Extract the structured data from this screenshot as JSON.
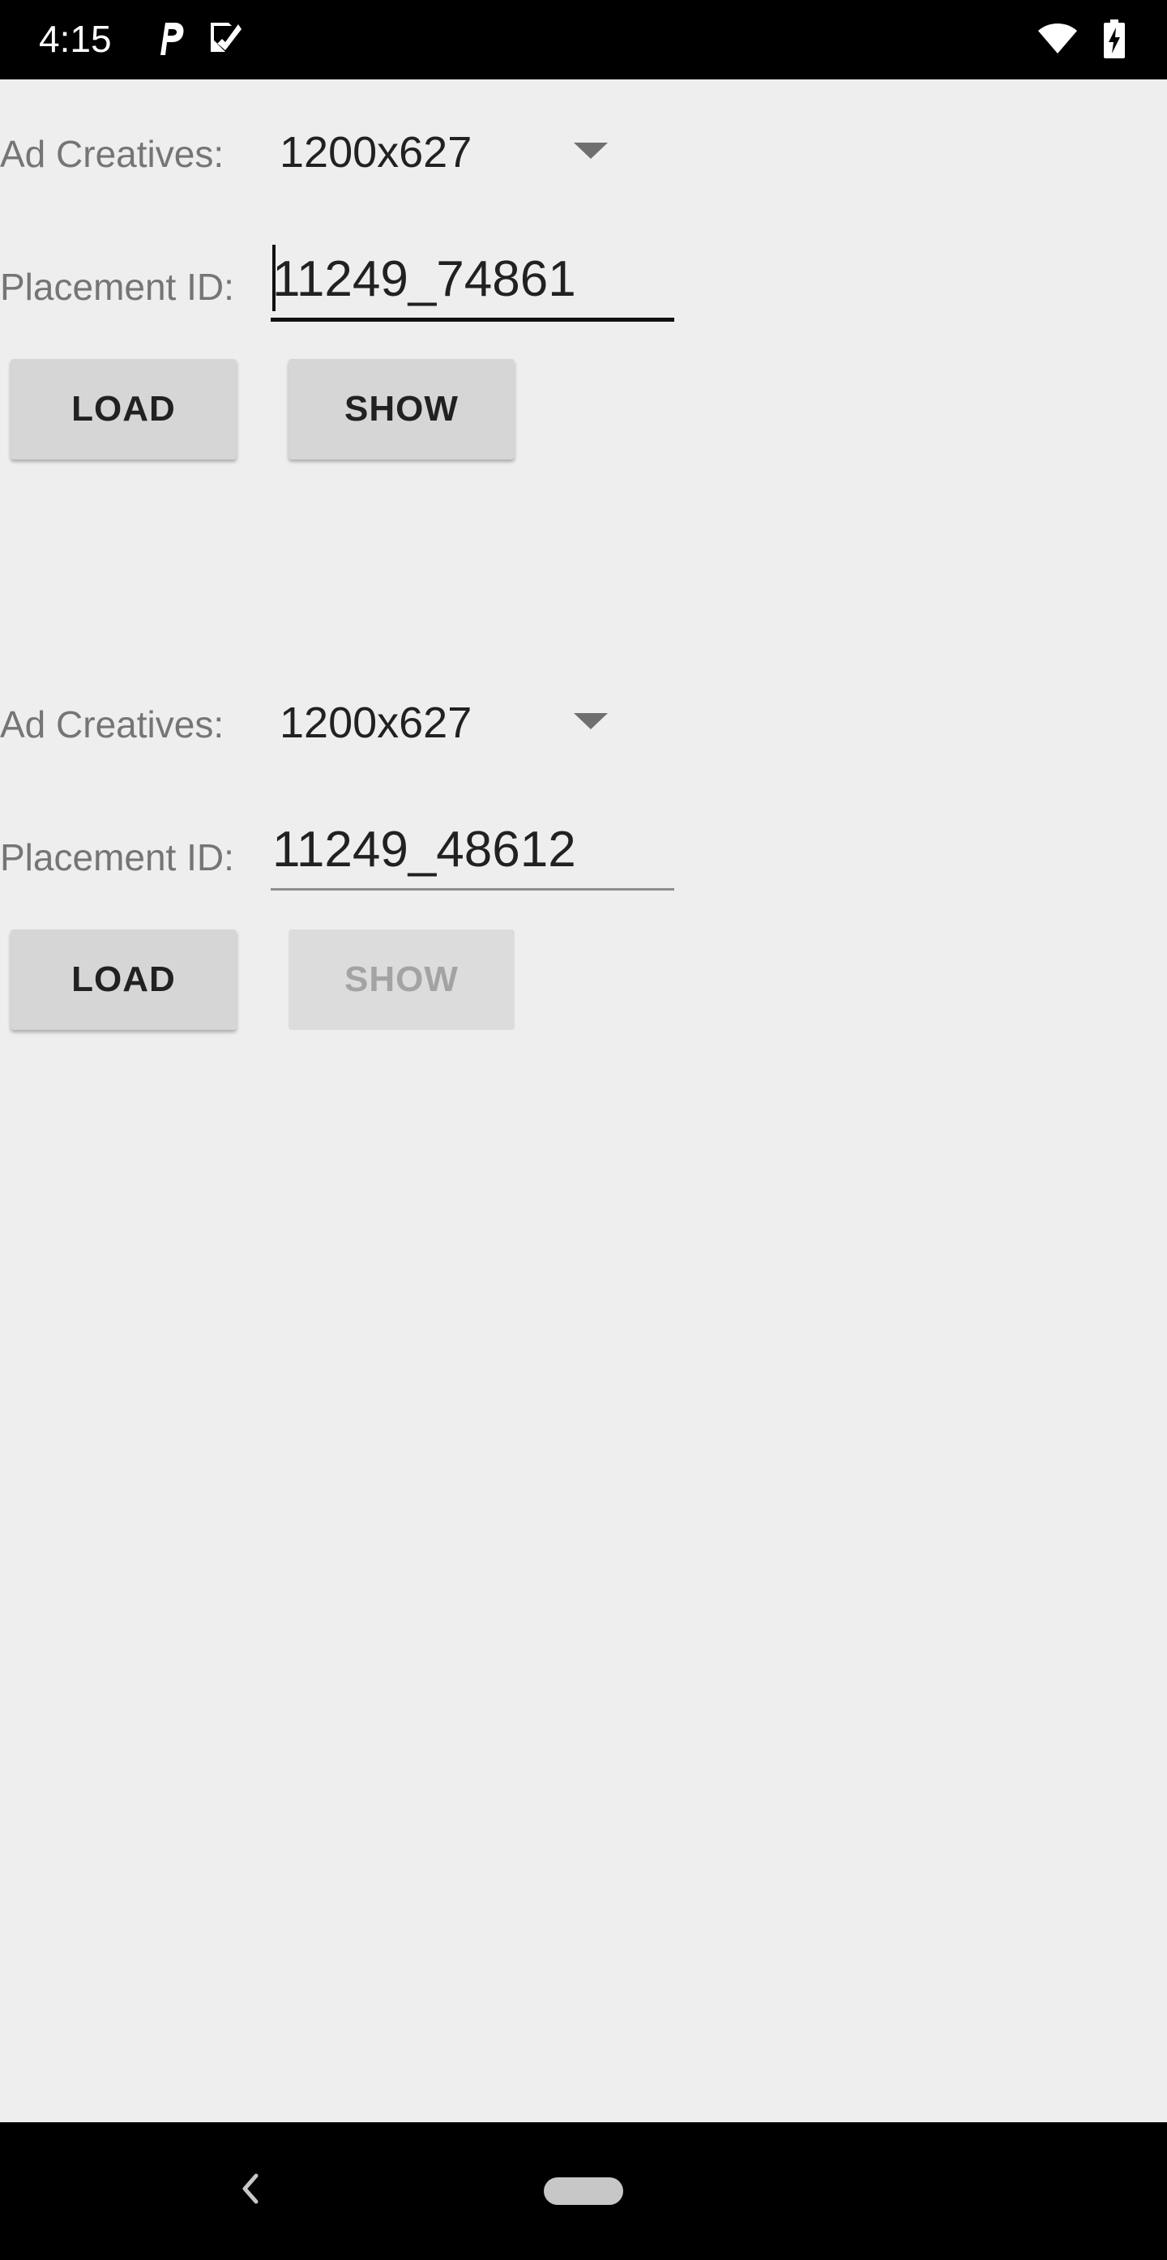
{
  "status_bar": {
    "time": "4:15",
    "left_icons": [
      "parking-icon",
      "task-check-icon"
    ],
    "right_icons": [
      "wifi-icon",
      "battery-charging-icon"
    ]
  },
  "sections": [
    {
      "ad_creatives_label": "Ad Creatives:",
      "ad_creatives_value": "1200x627",
      "placement_label": "Placement ID:",
      "placement_value": "11249_74861",
      "placement_focused": true,
      "load_label": "LOAD",
      "show_label": "SHOW",
      "show_enabled": true
    },
    {
      "ad_creatives_label": "Ad Creatives:",
      "ad_creatives_value": "1200x627",
      "placement_label": "Placement ID:",
      "placement_value": "11249_48612",
      "placement_focused": false,
      "load_label": "LOAD",
      "show_label": "SHOW",
      "show_enabled": false
    }
  ],
  "nav_bar": {
    "icons": [
      "back-icon",
      "home-pill-icon"
    ]
  },
  "colors": {
    "background": "#eeeeee",
    "button": "#d6d6d6",
    "label_text": "#757575"
  }
}
